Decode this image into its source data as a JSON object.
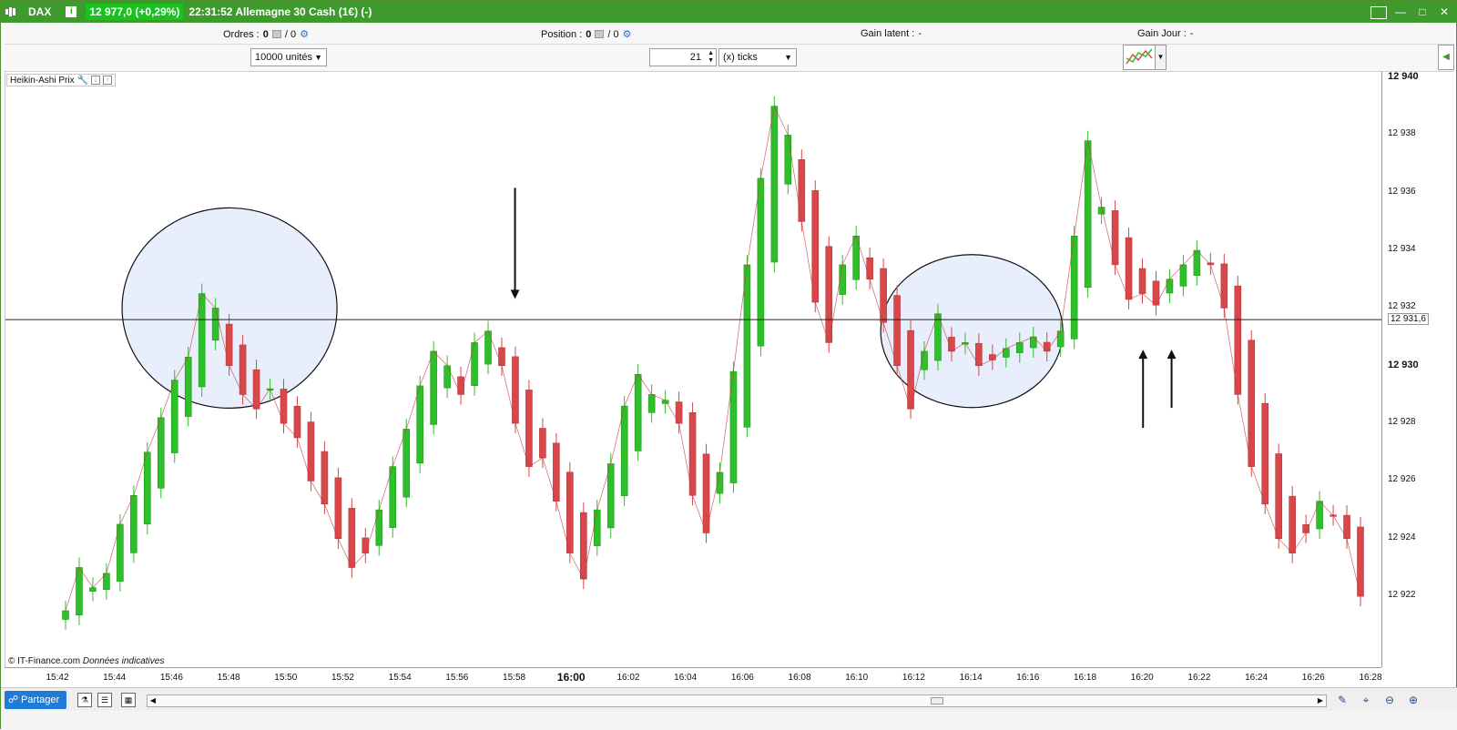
{
  "window": {
    "symbol": "DAX",
    "info_icon": "i",
    "price_badge": "12 977,0 (+0,29%)",
    "description": "22:31:52 Allemagne 30 Cash (1€) (-)"
  },
  "order_bar": {
    "orders_label": "Ordres :",
    "orders_value": "0",
    "orders_sep": "/ 0",
    "position_label": "Position :",
    "position_value": "0",
    "position_sep": "/ 0",
    "gain_latent_label": "Gain latent :",
    "gain_latent_value": "-",
    "gain_jour_label": "Gain Jour :",
    "gain_jour_value": "-"
  },
  "controls": {
    "quantity": "10000 unités",
    "interval_value": "21",
    "interval_unit": "(x) ticks"
  },
  "indicator": {
    "label": "Heikin-Ashi Prix"
  },
  "copyright": {
    "owner": "© IT-Finance.com",
    "note": "Données indicatives"
  },
  "y_axis": {
    "labels": [
      {
        "text": "12 940",
        "bold": true
      },
      {
        "text": "12 938",
        "bold": false
      },
      {
        "text": "12 936",
        "bold": false
      },
      {
        "text": "12 934",
        "bold": false
      },
      {
        "text": "12 932",
        "bold": false
      },
      {
        "text": "12 931,6",
        "bold": false,
        "current": true
      },
      {
        "text": "12 930",
        "bold": true
      },
      {
        "text": "12 928",
        "bold": false
      },
      {
        "text": "12 926",
        "bold": false
      },
      {
        "text": "12 924",
        "bold": false
      },
      {
        "text": "12 922",
        "bold": false
      }
    ]
  },
  "x_axis": {
    "labels": [
      "15:42",
      "15:44",
      "15:46",
      "15:48",
      "15:50",
      "15:52",
      "15:54",
      "15:56",
      "15:58",
      "16:00",
      "16:02",
      "16:04",
      "16:06",
      "16:08",
      "16:10",
      "16:12",
      "16:14",
      "16:16",
      "16:18",
      "16:20",
      "16:22",
      "16:24",
      "16:26",
      "16:28"
    ]
  },
  "bottom": {
    "share_label": "Partager"
  },
  "colors": {
    "title_green": "#3f9a2e",
    "price_green": "#19c21e",
    "candle_up": "#2ec02a",
    "candle_down": "#d9474a",
    "circle_fill": "#e8eefc",
    "share_blue": "#1f7ad8"
  },
  "chart_data": {
    "type": "candlestick",
    "chart_style": "Heikin-Ashi",
    "ylim": [
      12920.3,
      12940.0
    ],
    "reference_line": 12931.6,
    "current_price_label": "12 931,6",
    "x_ticks": [
      "15:42",
      "15:44",
      "15:46",
      "15:48",
      "15:50",
      "15:52",
      "15:54",
      "15:56",
      "15:58",
      "16:00",
      "16:02",
      "16:04",
      "16:06",
      "16:08",
      "16:10",
      "16:12",
      "16:14",
      "16:16",
      "16:18",
      "16:20",
      "16:22",
      "16:24",
      "16:26",
      "16:28"
    ],
    "series": [
      {
        "values": [
          12921.5,
          12923.0,
          12922.3,
          12922.8,
          12924.5,
          12925.5,
          12927.0,
          12928.2,
          12929.5,
          12930.3,
          12932.5,
          12932.0,
          12930.0,
          12929.0,
          12928.5,
          12929.2,
          12928.0,
          12927.5,
          12926.0,
          12925.2,
          12924.0,
          12923.0,
          12923.5,
          12925.0,
          12926.5,
          12927.8,
          12929.3,
          12930.5,
          12930.0,
          12929.0,
          12930.8,
          12931.2,
          12930.0,
          12928.0,
          12926.5,
          12926.8,
          12925.3,
          12923.5,
          12922.6,
          12925.0,
          12926.6,
          12928.6,
          12929.7,
          12929.0,
          12928.8,
          12928.0,
          12925.5,
          12924.2,
          12926.3,
          12929.8,
          12933.5,
          12936.5,
          12939.0,
          12938.0,
          12935.0,
          12932.2,
          12930.8,
          12933.5,
          12934.5,
          12933.0,
          12931.5,
          12930.0,
          12928.5,
          12930.5,
          12931.8,
          12930.5,
          12930.8,
          12930.0,
          12930.2,
          12930.6,
          12930.8,
          12931.0,
          12930.5,
          12931.2,
          12934.5,
          12937.8,
          12935.5,
          12933.5,
          12932.3,
          12932.5,
          12932.1,
          12933.0,
          12933.5,
          12934.0,
          12933.5,
          12932.0,
          12929.0,
          12926.5,
          12925.2,
          12924.0,
          12923.5,
          12924.2,
          12925.3,
          12924.8,
          12924.0,
          12922.0
        ]
      }
    ],
    "annotations": [
      {
        "type": "circle",
        "center_time": "15:48",
        "center_price": 12932.0
      },
      {
        "type": "circle",
        "center_time": "16:14",
        "center_price": 12931.2
      },
      {
        "type": "arrow",
        "direction": "down",
        "time": "15:58",
        "price": 12932.0
      },
      {
        "type": "arrow",
        "direction": "up",
        "time": "16:20",
        "price": 12931.0
      },
      {
        "type": "arrow",
        "direction": "up",
        "time": "16:21",
        "price": 12931.0
      }
    ]
  }
}
